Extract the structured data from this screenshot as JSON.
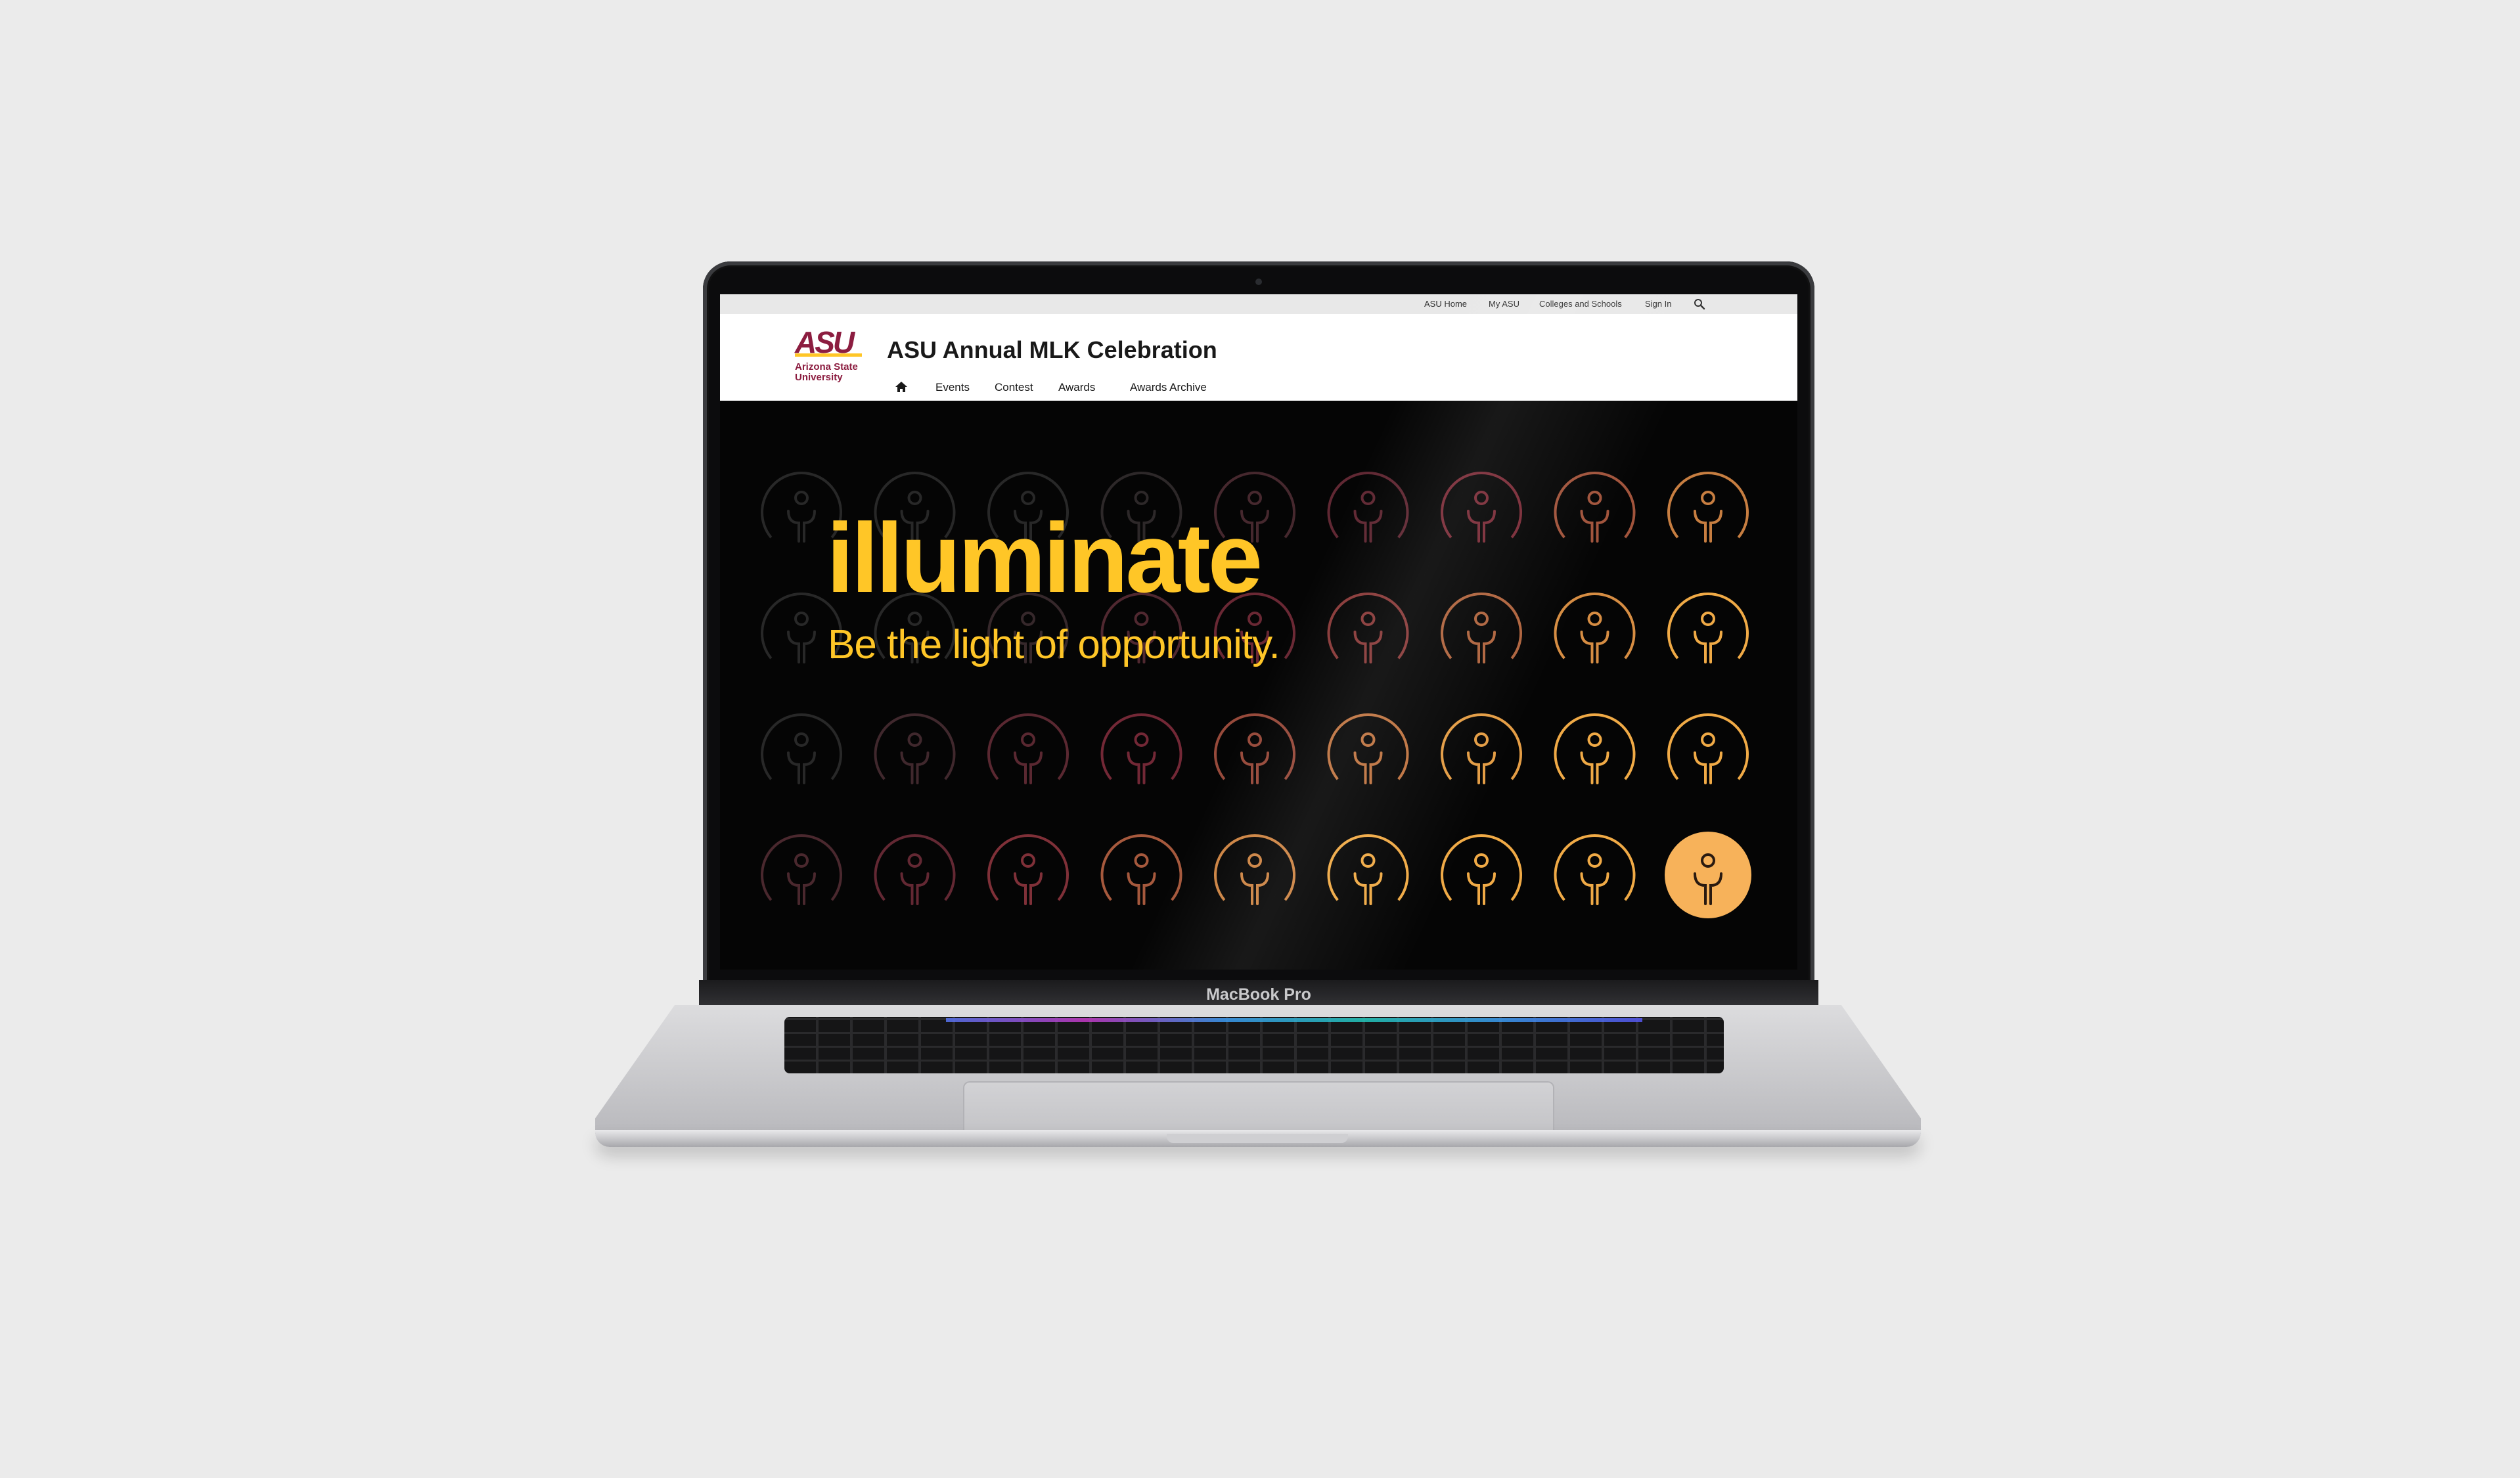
{
  "device": {
    "brand_label": "MacBook Pro"
  },
  "utility_nav": {
    "links": [
      "ASU Home",
      "My ASU",
      "Colleges and Schools",
      "Sign In"
    ],
    "search_icon": "search-icon"
  },
  "header": {
    "logo": {
      "mark": "ASU",
      "line1": "Arizona State",
      "line2": "University"
    },
    "site_title": "ASU Annual MLK Celebration",
    "nav": {
      "home_icon": "home-icon",
      "items": [
        "Events",
        "Contest",
        "Awards",
        "Awards Archive"
      ]
    }
  },
  "hero": {
    "title": "illuminate",
    "subtitle": "Be the light of opportunity.",
    "pattern_icon": "person-in-circle-icon",
    "highlighted_icon": "person-in-filled-circle-icon"
  },
  "colors": {
    "asu_gold": "#ffc627",
    "asu_maroon": "#8c1d40",
    "hero_background": "#050505",
    "utility_bar": "#e8e8e8"
  }
}
